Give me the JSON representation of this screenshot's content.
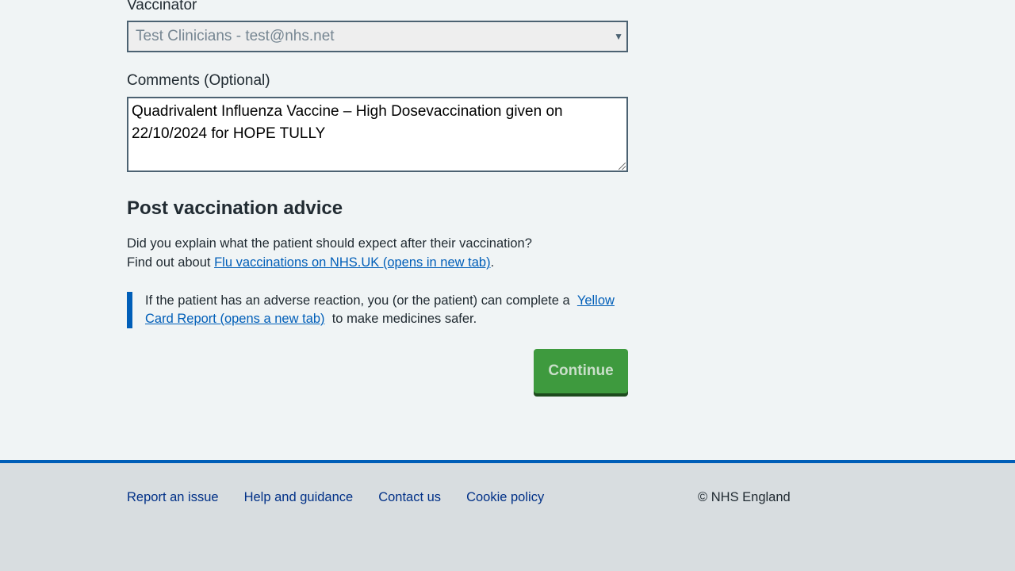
{
  "vaccinator": {
    "label": "Vaccinator",
    "selected": "Test Clinicians - test@nhs.net"
  },
  "comments": {
    "label": "Comments (Optional)",
    "value": "Quadrivalent Influenza Vaccine – High Dosevaccination given on 22/10/2024 for HOPE TULLY"
  },
  "advice": {
    "heading": "Post vaccination advice",
    "question": "Did you explain what the patient should expect after their vaccination?",
    "find_out_prefix": "Find out about ",
    "flu_link": "Flu vaccinations on NHS.UK (opens in new tab)",
    "find_out_suffix": "."
  },
  "inset": {
    "text_before": "If the patient has an adverse reaction, you (or the patient) can complete a ",
    "yellow_card_link": "Yellow Card Report (opens a new tab)",
    "text_after": " to make medicines safer."
  },
  "continue_button": "Continue",
  "footer": {
    "links": [
      "Report an issue",
      "Help and guidance",
      "Contact us",
      "Cookie policy"
    ],
    "copyright": "© NHS England"
  },
  "colors": {
    "nhs_blue": "#005eb8",
    "button_green": "#3e9a3e",
    "page_bg": "#f0f4f5",
    "footer_bg": "#d8dde0"
  }
}
